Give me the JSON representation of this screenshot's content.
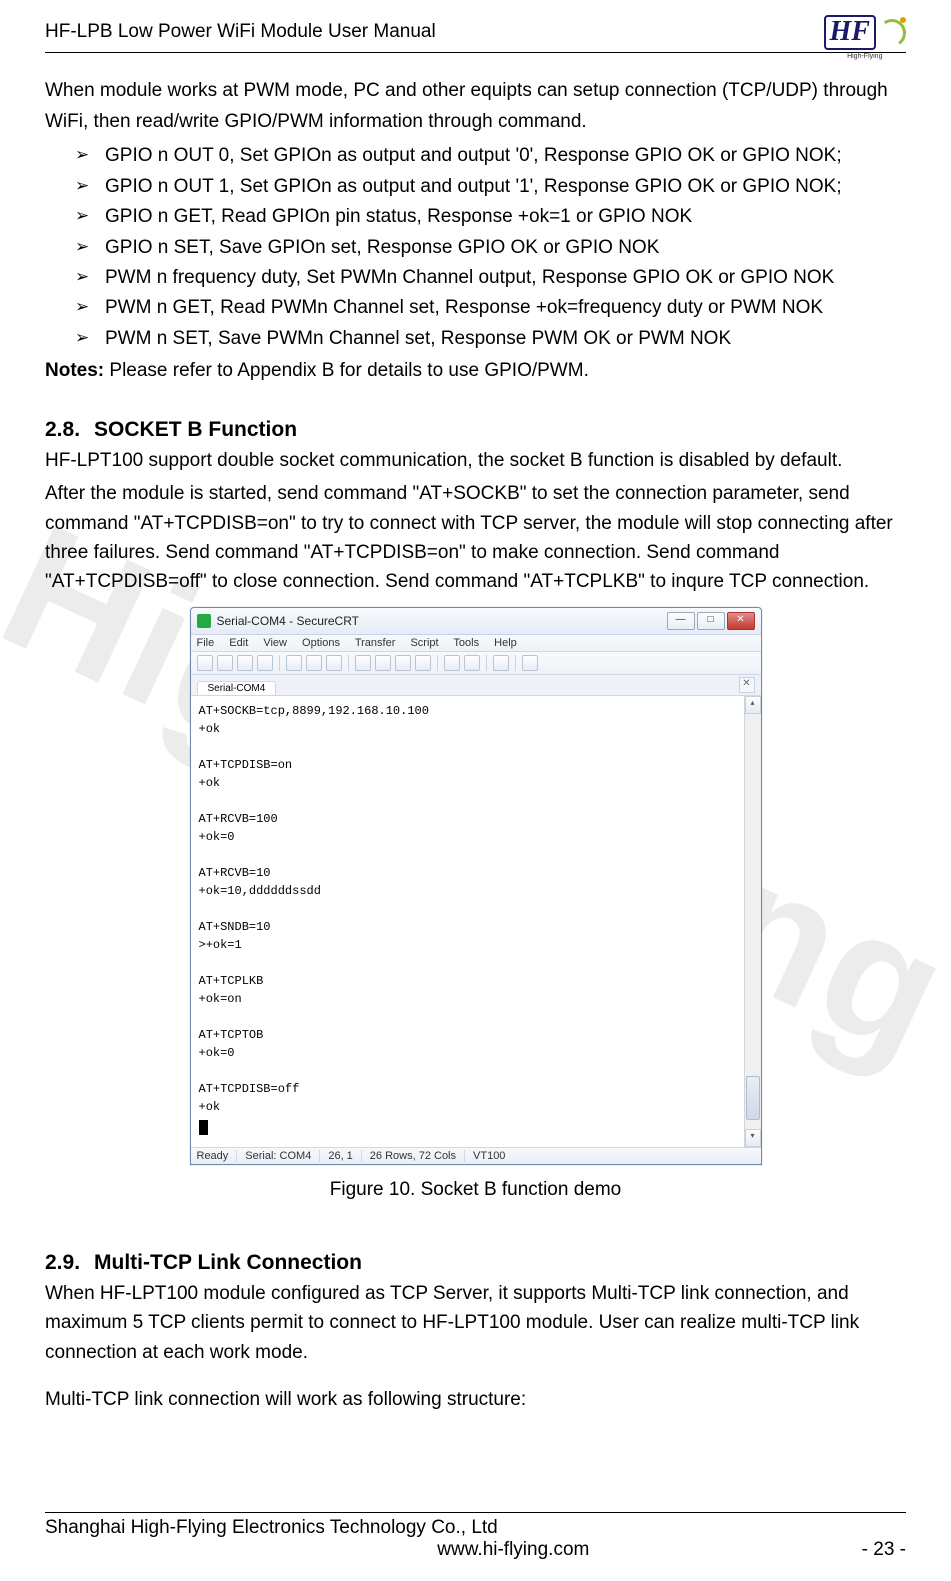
{
  "header": {
    "title": "HF-LPB Low Power WiFi Module User Manual",
    "logo_text": "HF",
    "logo_label": "High-Flying"
  },
  "watermark": "High-Flying",
  "intro": "When module works at PWM mode, PC and other equipts can setup connection (TCP/UDP) through WiFi, then read/write GPIO/PWM information through command.",
  "bullets": [
    "GPIO n OUT 0, Set GPIOn as output and output '0', Response GPIO OK or GPIO NOK;",
    "GPIO n OUT 1, Set GPIOn as output and output '1', Response GPIO OK or GPIO NOK;",
    "GPIO n GET, Read GPIOn pin status, Response +ok=1 or GPIO NOK",
    "GPIO n SET, Save GPIOn set, Response GPIO OK or GPIO NOK",
    "PWM n frequency duty, Set PWMn Channel output, Response GPIO OK or GPIO NOK",
    "PWM n GET, Read PWMn Channel set, Response +ok=frequency duty or PWM NOK",
    "PWM n SET, Save PWMn Channel set, Response PWM OK or PWM NOK"
  ],
  "notes_label": "Notes:",
  "notes_text": " Please refer to Appendix B for details to use GPIO/PWM.",
  "sec28": {
    "num": "2.8.",
    "title": "SOCKET B Function",
    "p1": "HF-LPT100 support double socket communication, the socket B function is disabled by default.",
    "p2": "After the module is started, send command \"AT+SOCKB\" to set the connection parameter, send command \"AT+TCPDISB=on\" to try to connect with TCP server, the module will stop connecting after three failures. Send command \"AT+TCPDISB=on\" to make connection. Send command \"AT+TCPDISB=off\" to close connection.  Send command \"AT+TCPLKB\" to inqure TCP connection."
  },
  "crt": {
    "title": "Serial-COM4 - SecureCRT",
    "menus": [
      "File",
      "Edit",
      "View",
      "Options",
      "Transfer",
      "Script",
      "Tools",
      "Help"
    ],
    "tab": "Serial-COM4",
    "terminal": "AT+SOCKB=tcp,8899,192.168.10.100\n+ok\n\nAT+TCPDISB=on\n+ok\n\nAT+RCVB=100\n+ok=0\n\nAT+RCVB=10\n+ok=10,ddddddssdd\n\nAT+SNDB=10\n>+ok=1\n\nAT+TCPLKB\n+ok=on\n\nAT+TCPTOB\n+ok=0\n\nAT+TCPDISB=off\n+ok",
    "status": [
      "Ready",
      "Serial: COM4",
      "26,   1",
      "26 Rows,  72 Cols",
      "VT100"
    ]
  },
  "fig_caption": "Figure 10.   Socket B function demo",
  "sec29": {
    "num": "2.9.",
    "title": "Multi-TCP Link Connection",
    "p1": "When HF-LPT100 module configured as TCP Server, it supports Multi-TCP link connection, and maximum 5 TCP clients permit to connect to HF-LPT100 module. User can realize multi-TCP link connection at each work mode.",
    "p2": "Multi-TCP link connection will work as following structure:"
  },
  "footer": {
    "company": "Shanghai High-Flying Electronics Technology Co., Ltd",
    "url": "www.hi-flying.com",
    "page": "- 23 -"
  }
}
